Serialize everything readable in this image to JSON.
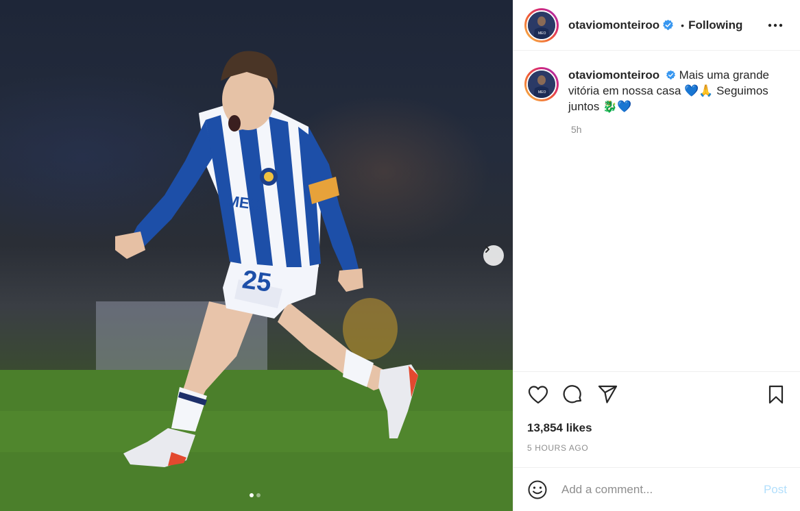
{
  "post": {
    "username": "otaviomonteiroo",
    "follow_status": "Following",
    "separator": "•",
    "caption": "Mais uma grande vitória em nossa casa 💙🙏 Seguimos juntos 🐉💙",
    "caption_time": "5h",
    "likes": "13,854 likes",
    "time_ago": "5 HOURS AGO",
    "jersey_number": "25"
  },
  "comment": {
    "placeholder": "Add a comment...",
    "post_label": "Post"
  },
  "carousel": {
    "total": 2,
    "active": 1
  },
  "icons": {
    "verified": "verified-badge-icon",
    "more": "more-options-icon",
    "like": "heart-icon",
    "comment": "comment-icon",
    "share": "share-icon",
    "save": "bookmark-icon",
    "emoji": "smiley-icon",
    "next": "chevron-right-icon"
  },
  "colors": {
    "verified": "#3897f0",
    "post_disabled": "#b2dffc",
    "secondary_text": "#8e8e8e",
    "jersey_blue": "#1d4fa8"
  }
}
